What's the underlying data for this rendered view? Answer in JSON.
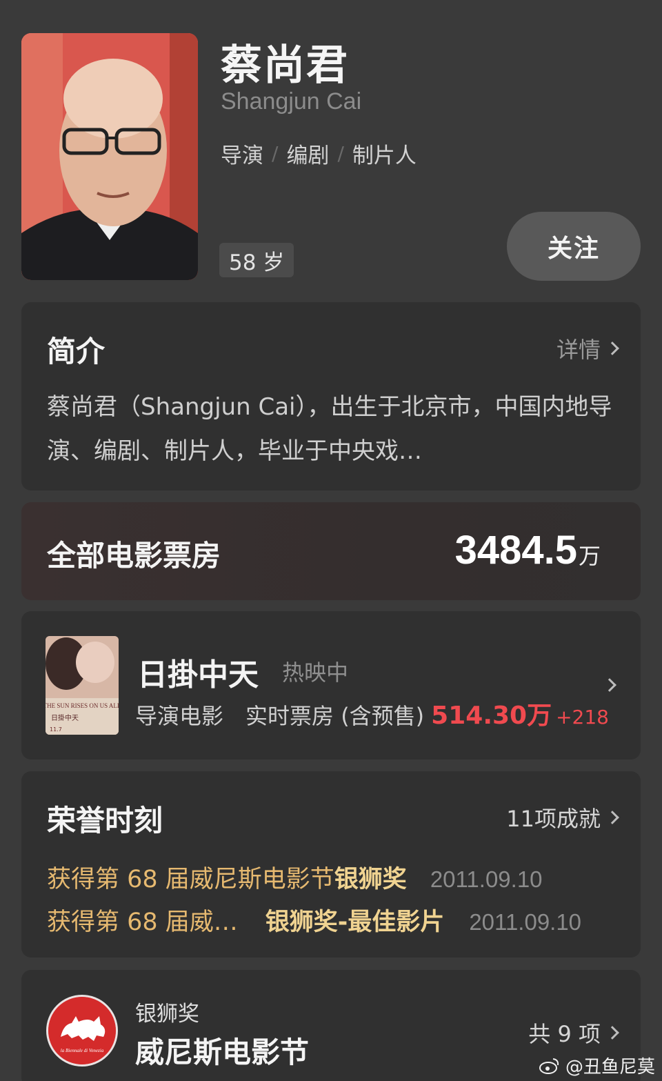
{
  "profile": {
    "name": "蔡尚君",
    "english_name": "Shangjun Cai",
    "roles": [
      "导演",
      "编剧",
      "制片人"
    ],
    "role_separator": "/",
    "age": "58 岁",
    "follow_label": "关注"
  },
  "intro": {
    "title": "简介",
    "more_label": "详情",
    "text": "蔡尚君（Shangjun Cai），出生于北京市，中国内地导演、编剧、制片人，毕业于中央戏…"
  },
  "box_office": {
    "label": "全部电影票房",
    "value": "3484.5",
    "unit": "万"
  },
  "movie": {
    "title": "日掛中天",
    "status": "热映中",
    "type": "导演电影",
    "realtime_label": "实时票房 (含预售)",
    "amount": "514.30万",
    "delta": "+218",
    "poster_text": "THE SUN RISES ON US ALL",
    "poster_title": "日掛中天",
    "poster_date": "11.7"
  },
  "honors": {
    "title": "荣誉时刻",
    "count_label": "11项成就",
    "items": [
      {
        "text": "获得第 68 届威尼斯电影节 ",
        "award": "银狮奖",
        "date": "2011.09.10"
      },
      {
        "text": "获得第 68 届威…",
        "award": "银狮奖-最佳影片",
        "date": "2011.09.10"
      }
    ]
  },
  "award": {
    "subtitle": "银狮奖",
    "name": "威尼斯电影节",
    "count_label": "共 9 项",
    "logo_text": "la Biennale di Venezia"
  },
  "watermark": {
    "text": "@丑鱼尼莫"
  },
  "colors": {
    "background": "#3a3a3a",
    "card": "#303030",
    "accent_red": "#f04a4f",
    "honor_gold": "#e6b970"
  }
}
